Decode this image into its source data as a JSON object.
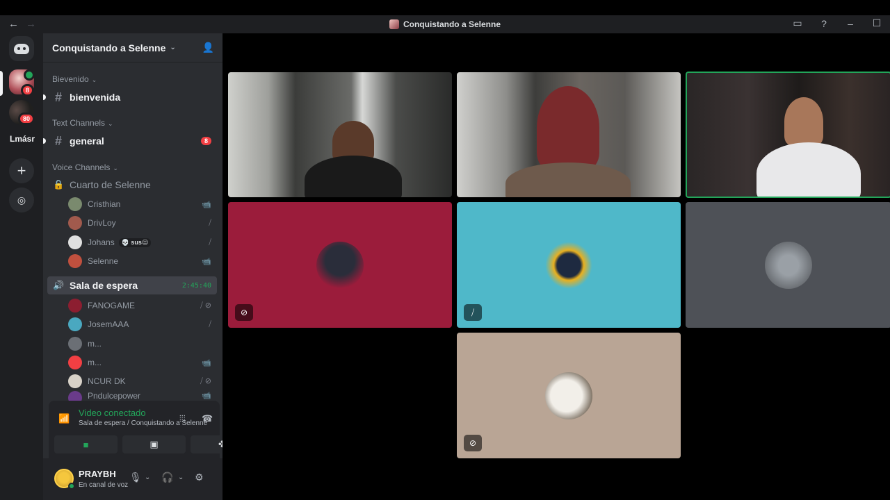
{
  "window": {
    "title": "Conquistando a Selenne",
    "nav_back": "←",
    "nav_forward": "→",
    "controls": [
      "▭",
      "?",
      "–",
      "☐"
    ]
  },
  "rail": {
    "server1_badge": "8",
    "server2_badge": "80",
    "folder_label": "Lmásr",
    "add_label": "+",
    "explore_label": "◎"
  },
  "sidebar": {
    "server_name": "Conquistando a Selenne",
    "categories": {
      "bienvenido": "Bievenido",
      "text": "Text Channels",
      "voice": "Voice Channels"
    },
    "channels": {
      "bienvenida": "bienvenida",
      "general": "general",
      "general_badge": "8"
    },
    "voice_channels": [
      {
        "name": "Cuarto de Selenne",
        "users": [
          {
            "name": "Cristhian",
            "icon": "📹",
            "color": "#7a8a6e"
          },
          {
            "name": "DrivLoy",
            "icon": "⧸",
            "color": "#a15a4d"
          },
          {
            "name": "Johans",
            "tag": "💀 sus😐",
            "icon": "⧸",
            "color": "#e0e0e0"
          },
          {
            "name": "Selenne",
            "icon": "📹",
            "color": "#c0503e"
          }
        ]
      },
      {
        "name": "Sala de espera",
        "timer": "2:45:40",
        "users": [
          {
            "name": "FANOGAME",
            "icon": "⧸ ⊘",
            "color": "#8c1e30"
          },
          {
            "name": "JosemAAA",
            "icon": "⧸",
            "color": "#4aa8c0"
          },
          {
            "name": "m...",
            "icon": "",
            "color": "#6b6f75"
          },
          {
            "name": "m...",
            "icon": "📹",
            "color": "#f23f43"
          },
          {
            "name": "NCUR DK",
            "icon": "⧸ ⊘",
            "color": "#d8d2c8"
          },
          {
            "name": "Pndulcepower",
            "icon": "📹",
            "color": "#6a3b8a"
          }
        ]
      }
    ]
  },
  "voice_panel": {
    "status": "Video conectado",
    "location": "Sala de espera / Conquistando a Selenne"
  },
  "user_panel": {
    "username": "PRAYBH",
    "status": "En canal de voz"
  },
  "stage": {
    "tiles": [
      {
        "kind": "camera",
        "name": "cam-cristhian"
      },
      {
        "kind": "camera",
        "name": "cam-selenne"
      },
      {
        "kind": "camera",
        "name": "cam-speaking",
        "speaking": true
      },
      {
        "kind": "avatar",
        "name": "FANOGAME",
        "bg": "#9b1c3b",
        "muted_icon": "⊘"
      },
      {
        "kind": "avatar",
        "name": "JosemAAA",
        "bg": "#4fb8c9",
        "muted_icon": "⧸"
      },
      {
        "kind": "avatar",
        "name": "m...",
        "bg": "#4e5157"
      },
      {
        "kind": "avatar",
        "name": "NCUR DK",
        "bg": "#b9a595",
        "muted_icon": "⊘"
      }
    ]
  }
}
